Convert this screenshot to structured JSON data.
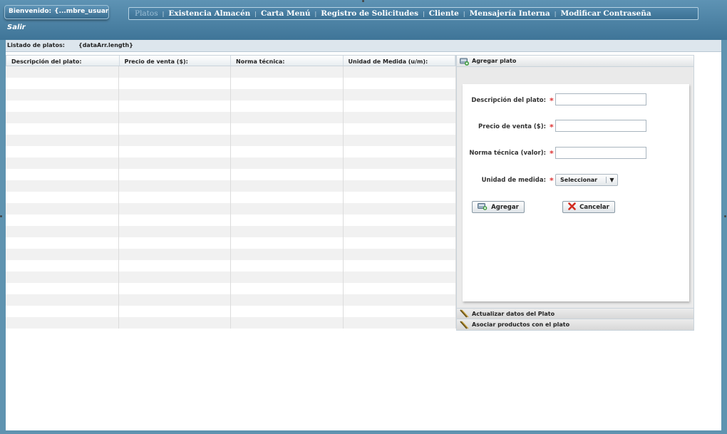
{
  "header": {
    "welcome_label": "Bienvenido:",
    "welcome_user": "{...mbre_usuari...",
    "logout": "Salir"
  },
  "menu": {
    "items": [
      {
        "label": "Platos",
        "active": true
      },
      {
        "label": "Existencia Almacén"
      },
      {
        "label": "Carta Menú"
      },
      {
        "label": "Registro de Solicitudes"
      },
      {
        "label": "Cliente"
      },
      {
        "label": "Mensajería Interna"
      },
      {
        "label": "Modificar Contraseña"
      }
    ]
  },
  "list": {
    "label": "Listado de platos:",
    "count": "{dataArr.length}",
    "columns": [
      "Descripción del plato:",
      "Precio de venta ($):",
      "Norma técnica:",
      "Unidad de Medida (u/m):"
    ]
  },
  "panel": {
    "add_header": "Agregar plato",
    "form": {
      "descripcion_label": "Descripción del plato:",
      "precio_label": "Precio de venta ($):",
      "norma_label": "Norma técnica (valor):",
      "unidad_label": "Unidad de medida:",
      "unidad_value": "Seleccionar",
      "required_mark": "*",
      "add_button": "Agregar",
      "cancel_button": "Cancelar"
    },
    "update_header": "Actualizar datos del Plato",
    "associate_header": "Asociar productos con el plato"
  },
  "colors": {
    "accent": "#4a80a4",
    "required": "#dd3333"
  }
}
